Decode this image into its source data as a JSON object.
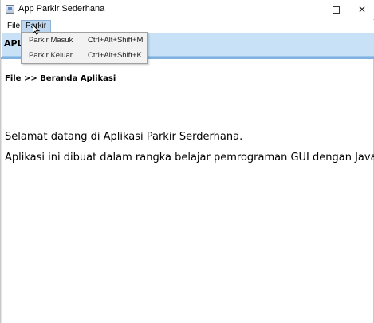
{
  "window": {
    "title": "App Parkir Sederhana",
    "icon": "java-app-icon",
    "controls": {
      "minimize": "minimize-icon",
      "maximize": "maximize-icon",
      "close_glyph": "✕"
    }
  },
  "menubar": {
    "items": [
      {
        "label": "File"
      },
      {
        "label": "Parkir",
        "state": "open"
      }
    ]
  },
  "parkir_menu": {
    "items": [
      {
        "label": "Parkir Masuk",
        "accelerator": "Ctrl+Alt+Shift+M"
      },
      {
        "label": "Parkir Keluar",
        "accelerator": "Ctrl+Alt+Shift+K"
      }
    ]
  },
  "header": {
    "text": "APL"
  },
  "content": {
    "breadcrumb": "File >> Beranda Aplikasi",
    "welcome_line1": "Selamat datang di Aplikasi Parkir Serderhana.",
    "welcome_line2": "Aplikasi ini dibuat dalam rangka belajar pemrograman GUI dengan Java."
  },
  "colors": {
    "header_band": "#c8e1f7",
    "menu_highlight": "#bfd6ef",
    "header_border": "#7fb2e0"
  }
}
